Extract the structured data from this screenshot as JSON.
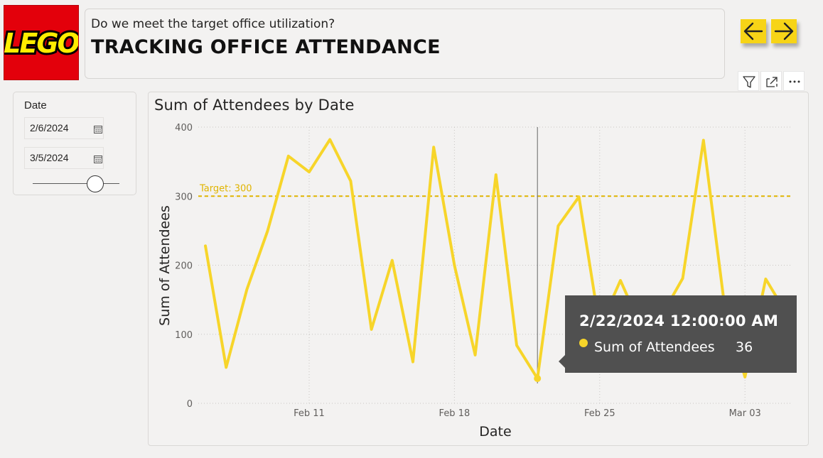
{
  "header": {
    "logo_text": "LEGO",
    "subtitle": "Do we meet the target office utilization?",
    "title": "TRACKING OFFICE ATTENDANCE"
  },
  "navigation": {
    "back_icon": "arrow-left-icon",
    "forward_icon": "arrow-right-icon"
  },
  "visual_header_icons": [
    "filter-icon",
    "focus-mode-icon",
    "more-options-icon"
  ],
  "slicer": {
    "title": "Date",
    "start_date": "2/6/2024",
    "end_date": "3/5/2024",
    "slider_position_fraction": 0.82
  },
  "colors": {
    "line": "#f7d52a",
    "target": "#e0b400",
    "tooltip_bg": "#505050",
    "brand_red": "#e3000b",
    "button_yellow": "#f7d417"
  },
  "chart_data": {
    "type": "line",
    "title": "Sum of Attendees by Date",
    "xlabel": "Date",
    "ylabel": "Sum of Attendees",
    "ylim": [
      0,
      400
    ],
    "yticks": [
      0,
      100,
      200,
      300,
      400
    ],
    "xticks": [
      {
        "date": "2024-02-11",
        "label": "Feb 11"
      },
      {
        "date": "2024-02-18",
        "label": "Feb 18"
      },
      {
        "date": "2024-02-25",
        "label": "Feb 25"
      },
      {
        "date": "2024-03-03",
        "label": "Mar 03"
      }
    ],
    "x": [
      "2024-02-06",
      "2024-02-07",
      "2024-02-08",
      "2024-02-09",
      "2024-02-10",
      "2024-02-11",
      "2024-02-12",
      "2024-02-13",
      "2024-02-14",
      "2024-02-15",
      "2024-02-16",
      "2024-02-17",
      "2024-02-18",
      "2024-02-19",
      "2024-02-20",
      "2024-02-21",
      "2024-02-22",
      "2024-02-23",
      "2024-02-24",
      "2024-02-25",
      "2024-02-26",
      "2024-02-27",
      "2024-02-28",
      "2024-02-29",
      "2024-03-01",
      "2024-03-02",
      "2024-03-03",
      "2024-03-04",
      "2024-03-05"
    ],
    "series": [
      {
        "name": "Sum of Attendees",
        "values": [
          228,
          52,
          165,
          250,
          358,
          335,
          382,
          322,
          107,
          207,
          60,
          371,
          200,
          70,
          331,
          84,
          36,
          257,
          299,
          110,
          178,
          110,
          128,
          181,
          381,
          145,
          38,
          180,
          130
        ]
      }
    ],
    "grid": true,
    "target": {
      "value": 300,
      "label": "Target: 300"
    },
    "hover_x": "2024-02-22",
    "tooltip": {
      "title": "2/22/2024 12:00:00 AM",
      "label": "Sum of Attendees",
      "value": "36"
    }
  }
}
